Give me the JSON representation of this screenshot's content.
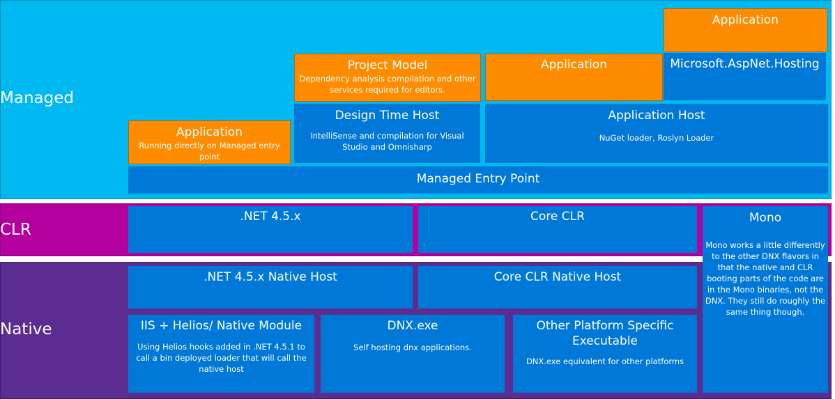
{
  "colors": {
    "managed_band": "#00b9f1",
    "clr_band": "#b4009e",
    "native_band": "#5c2d91",
    "component_blue": "#0078d7",
    "application_orange": "#ff8c00"
  },
  "layers": {
    "managed": {
      "label": "Managed",
      "app_direct": {
        "title": "Application",
        "desc": "Running  directly on Managed entry point"
      },
      "project_model": {
        "title": "Project Model",
        "desc": "Dependency analysis compilation and other services required for editors."
      },
      "app_middle": {
        "title": "Application"
      },
      "app_top": {
        "title": "Application"
      },
      "aspnet_hosting": {
        "title": "Microsoft.AspNet.Hosting"
      },
      "design_time_host": {
        "title": "Design Time Host",
        "desc": "IntelliSense  and compilation for Visual Studio  and Omnisharp"
      },
      "application_host": {
        "title": "Application Host",
        "desc": "NuGet  loader, Roslyn Loader"
      },
      "entry_point": {
        "title": "Managed Entry Point"
      }
    },
    "clr": {
      "label": "CLR",
      "net45": {
        "title": ".NET 4.5.x"
      },
      "core_clr": {
        "title": "Core CLR"
      },
      "mono": {
        "title": "Mono",
        "desc": "Mono works a little  differently to the  other DNX flavors in that the  native and CLR booting parts of the  code are in the  Mono binaries, not the DNX. They still do roughly the same thing though."
      }
    },
    "native": {
      "label": "Native",
      "net45_native_host": {
        "title": ".NET 4.5.x  Native Host"
      },
      "core_clr_native_host": {
        "title": "Core CLR Native Host"
      },
      "iis_helios": {
        "title": "IIS + Helios/ Native Module",
        "desc": "Using Helios hooks added in .NET 4.5.1 to call a bin  deployed loader that will call the native  host"
      },
      "dnx_exe": {
        "title": "DNX.exe",
        "desc": "Self hosting  dnx applications."
      },
      "other_platform": {
        "title": "Other Platform Specific Executable",
        "desc": "DNX.exe equivalent for other platforms"
      }
    }
  }
}
